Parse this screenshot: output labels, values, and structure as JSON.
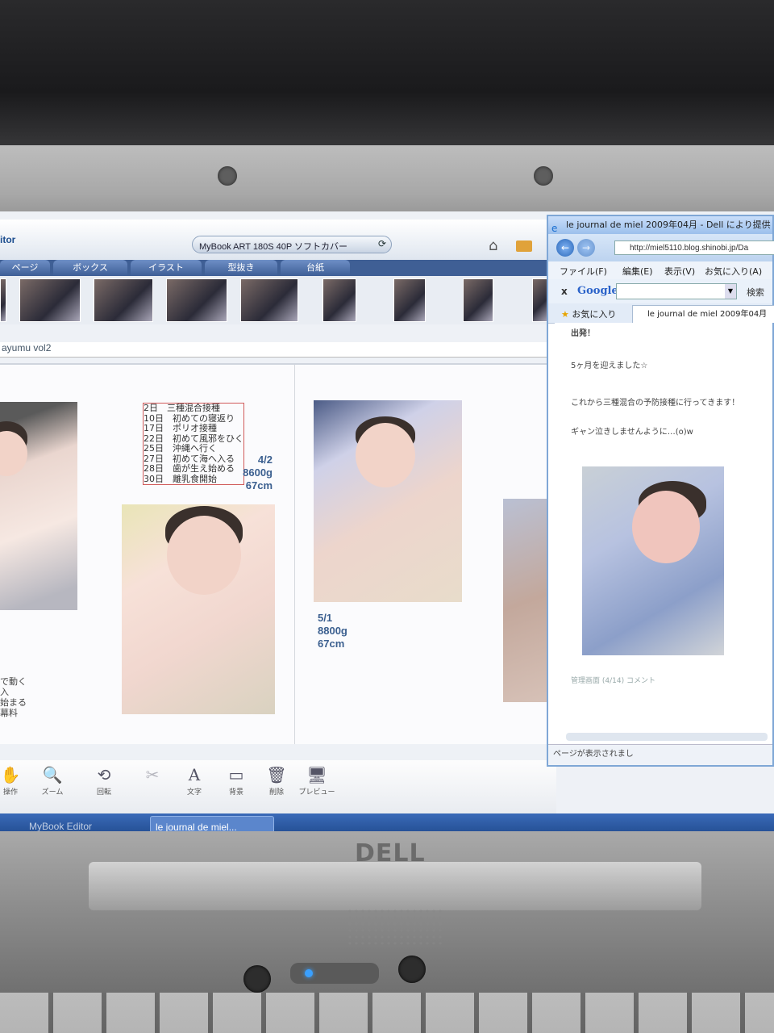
{
  "editor": {
    "brand": "itor",
    "title": "MyBook ART 180S 40P ソフトカバー",
    "tabs": [
      "ページ",
      "ボックス",
      "イラスト",
      "型抜き",
      "台紙"
    ],
    "project_name": "ayumu vol2",
    "memo": [
      {
        "day": "2日",
        "text": "三種混合接種"
      },
      {
        "day": "10日",
        "text": "初めての寝返り"
      },
      {
        "day": "17日",
        "text": "ポリオ接種"
      },
      {
        "day": "22日",
        "text": "初めて風邪をひく"
      },
      {
        "day": "25日",
        "text": "沖縄へ行く"
      },
      {
        "day": "27日",
        "text": "初めて海へ入る"
      },
      {
        "day": "28日",
        "text": "歯が生え始める"
      },
      {
        "day": "30日",
        "text": "離乳食開始"
      }
    ],
    "stat_april": {
      "date": "4/2",
      "weight": "8600g",
      "height": "67cm"
    },
    "stat_may": {
      "date": "5/1",
      "weight": "8800g",
      "height": "67cm"
    },
    "side_note": [
      "で動く",
      "入",
      "始まる",
      "幕料"
    ],
    "toolbar": [
      {
        "label": "操作",
        "icon": "hand-icon"
      },
      {
        "label": "ズーム",
        "icon": "zoom-icon"
      },
      {
        "label": "回転",
        "icon": "rotate-icon"
      },
      {
        "label": "",
        "icon": "cut-icon"
      },
      {
        "label": "文字",
        "icon": "text-icon"
      },
      {
        "label": "背景",
        "icon": "background-icon"
      },
      {
        "label": "削除",
        "icon": "trash-icon"
      },
      {
        "label": "プレビュー",
        "icon": "preview-icon"
      }
    ]
  },
  "browser": {
    "title": "le journal de miel 2009年04月 - Dell により提供",
    "url": "http://miel5110.blog.shinobi.jp/Da",
    "menu": [
      "ファイル(F)",
      "編集(E)",
      "表示(V)",
      "お気に入り(A)"
    ],
    "google_label": "Google",
    "search_label": "検索",
    "favorites_label": "お気に入り",
    "tab_title": "le journal de miel 2009年04月",
    "post_lines": [
      "出発！",
      "5ヶ月を迎えました☆",
      "これから三種混合の予防接種に行ってきます！",
      "ギャン泣きしませんように…(o)w"
    ],
    "post_meta": "管理画面  (4/14)    コメント",
    "status": "ページが表示されまし"
  },
  "taskbar": {
    "items": [
      "MyBook Editor",
      "le journal de miel..."
    ]
  },
  "laptop": {
    "brand": "DELL"
  }
}
